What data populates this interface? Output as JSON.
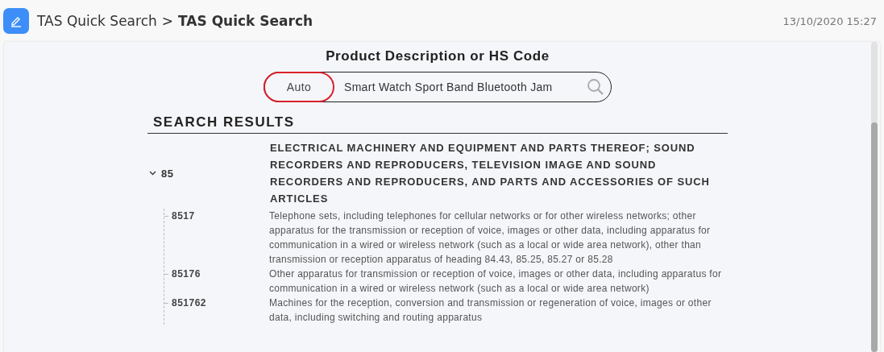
{
  "header": {
    "breadcrumb_parent": "TAS Quick Search",
    "separator": ">",
    "breadcrumb_current": "TAS Quick Search",
    "timestamp": "13/10/2020 15:27"
  },
  "search": {
    "title": "Product Description or HS Code",
    "mode": "Auto",
    "value": "Smart Watch Sport Band Bluetooth Jam"
  },
  "results": {
    "heading": "SEARCH RESULTS",
    "items": [
      {
        "code": "85",
        "expanded": true,
        "description": "ELECTRICAL MACHINERY AND EQUIPMENT AND PARTS THEREOF; SOUND RECORDERS AND REPRODUCERS, TELEVISION IMAGE AND SOUND RECORDERS AND REPRODUCERS, AND PARTS AND ACCESSORIES OF SUCH ARTICLES",
        "children": [
          {
            "code": "8517",
            "description": "Telephone sets, including telephones for cellular networks or for other wireless networks; other apparatus for the transmission or reception of voice, images or other data, including apparatus for communication in a wired or wireless network (such as a local or wide area network), other than transmission or reception apparatus of heading 84.43, 85.25, 85.27 or 85.28"
          },
          {
            "code": "85176",
            "description": "Other apparatus for transmission or reception of voice, images or other data, including apparatus for communication in a wired or wireless network (such as a local or wide area network)"
          },
          {
            "code": "851762",
            "description": "Machines for the reception, conversion and transmission or regeneration of voice, images or other data, including switching and routing apparatus"
          }
        ]
      }
    ]
  }
}
